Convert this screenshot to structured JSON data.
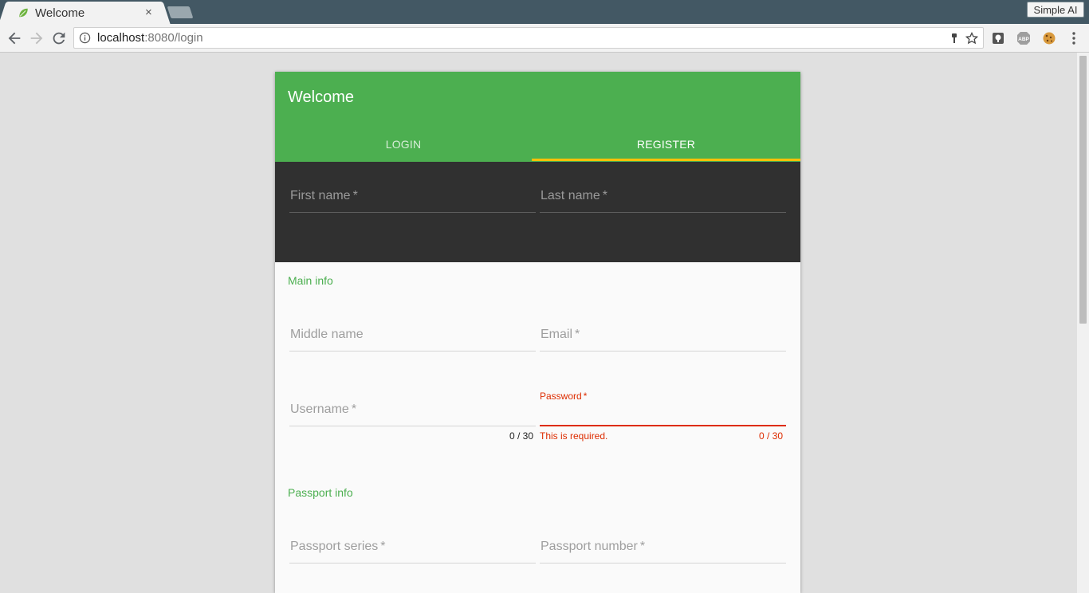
{
  "browser": {
    "tab_title": "Welcome",
    "tab_close": "×",
    "profile_label": "Simple AI",
    "url_host": "localhost",
    "url_path": ":8080/login"
  },
  "card": {
    "title": "Welcome",
    "tabs": [
      {
        "label": "LOGIN",
        "active": false
      },
      {
        "label": "REGISTER",
        "active": true
      }
    ],
    "colors": {
      "header": "#4caf50",
      "tab_ink": "#ffc107",
      "error": "#dd2c00",
      "dark_section": "#303030"
    }
  },
  "form": {
    "first_name": "First name",
    "last_name": "Last name",
    "main_info_title": "Main info",
    "middle_name": "Middle name",
    "email": "Email",
    "username": "Username",
    "username_counter": "0 / 30",
    "password": "Password",
    "password_error": "This is required.",
    "password_counter": "0 / 30",
    "passport_info_title": "Passport info",
    "passport_series": "Passport series",
    "passport_number": "Passport number",
    "required_mark": "*"
  }
}
